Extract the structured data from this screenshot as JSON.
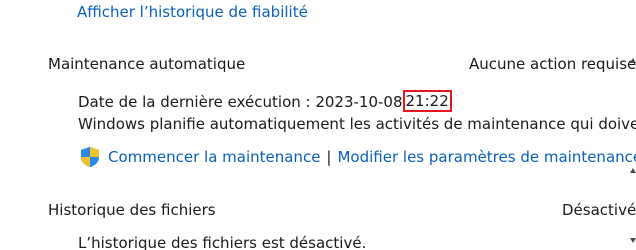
{
  "reliability_link": "Afficher l’historique de fiabilité",
  "maintenance": {
    "title": "Maintenance automatique",
    "status": "Aucune action requise",
    "last_run_label": "Date de la dernière exécution : 2023-10-08",
    "last_run_time": "21:22",
    "description": "Windows planifie automatiquement les activités de maintenance qui doivent",
    "start_link": "Commencer la maintenance",
    "separator": "|",
    "settings_link": "Modifier les paramètres de maintenance"
  },
  "file_history": {
    "title": "Historique des fichiers",
    "status": "Désactivé",
    "description": "L’historique des fichiers est désactivé."
  },
  "colors": {
    "link": "#0a5fb8",
    "highlight_border": "#e8141e"
  },
  "icons": {
    "shield": "uac-shield-icon"
  }
}
